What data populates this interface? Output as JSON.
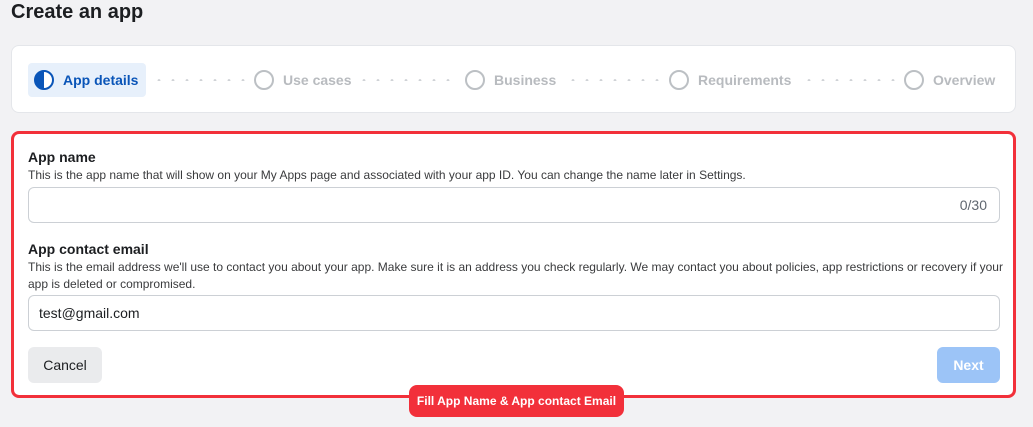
{
  "page": {
    "title": "Create an app"
  },
  "stepper": {
    "steps": [
      {
        "label": "App details",
        "active": true
      },
      {
        "label": "Use cases",
        "active": false
      },
      {
        "label": "Business",
        "active": false
      },
      {
        "label": "Requirements",
        "active": false
      },
      {
        "label": "Overview",
        "active": false
      }
    ]
  },
  "form": {
    "app_name": {
      "label": "App name",
      "help": "This is the app name that will show on your My Apps page and associated with your app ID. You can change the name later in Settings.",
      "value": "",
      "counter": "0/30"
    },
    "app_email": {
      "label": "App contact email",
      "help": "This is the email address we'll use to contact you about your app. Make sure it is an address you check regularly. We may contact you about policies, app restrictions or recovery if your app is deleted or compromised.",
      "value": "test@gmail.com"
    },
    "cancel_label": "Cancel",
    "next_label": "Next"
  },
  "annotation": {
    "callout_text": "Fill App Name & App contact Email"
  },
  "colors": {
    "accent": "#0a55b8",
    "highlight": "#f2303a",
    "next_disabled": "#9cc4f7"
  }
}
